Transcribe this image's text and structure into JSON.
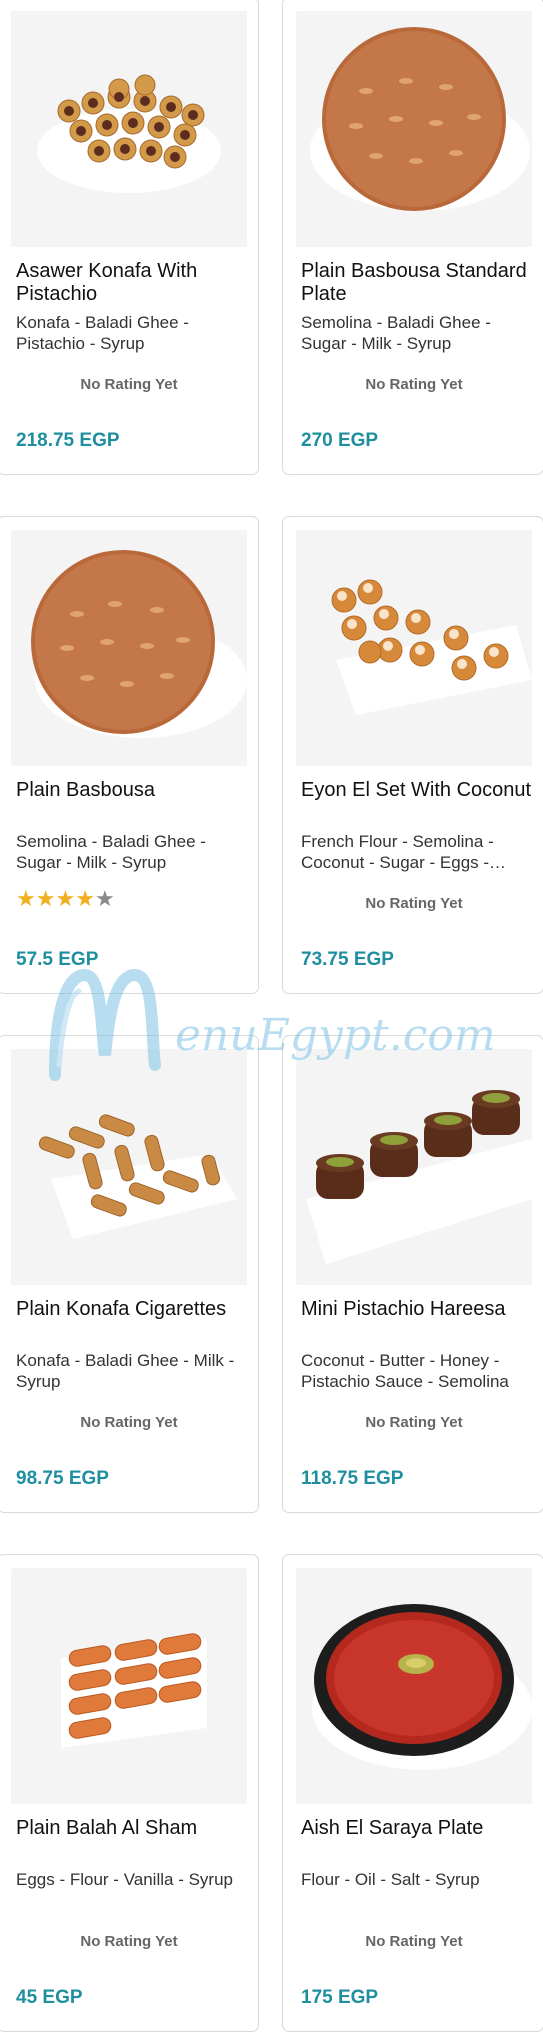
{
  "watermark": {
    "text": "enuEgypt.com"
  },
  "products": [
    {
      "name": "Asawer Konafa With Pistachio",
      "ingredients": "Konafa - Baladi Ghee - Pistachio - Syrup",
      "rating_text": "No Rating Yet",
      "price": "218.75 EGP",
      "image_icon": "asawer-konafa-photo"
    },
    {
      "name": "Plain Basbousa Standard Plate",
      "ingredients": "Semolina - Baladi Ghee - Sugar - Milk - Syrup",
      "rating_text": "No Rating Yet",
      "price": "270 EGP",
      "image_icon": "basbousa-plate-photo"
    },
    {
      "name": "Plain Basbousa",
      "ingredients": "Semolina - Baladi Ghee - Sugar - Milk - Syrup",
      "stars": 4,
      "stars_max": 5,
      "price": "57.5 EGP",
      "image_icon": "basbousa-photo"
    },
    {
      "name": "Eyon El Set With Coconut",
      "ingredients": "French Flour - Semolina - Coconut - Sugar - Eggs - Butter",
      "rating_text": "No Rating Yet",
      "price": "73.75 EGP",
      "image_icon": "eyon-el-set-photo"
    },
    {
      "name": "Plain Konafa Cigarettes",
      "ingredients": "Konafa - Baladi Ghee - Milk - Syrup",
      "rating_text": "No Rating Yet",
      "price": "98.75 EGP",
      "image_icon": "konafa-cigarettes-photo"
    },
    {
      "name": "Mini Pistachio Hareesa",
      "ingredients": "Coconut - Butter - Honey - Pistachio Sauce - Semolina",
      "rating_text": "No Rating Yet",
      "price": "118.75 EGP",
      "image_icon": "pistachio-hareesa-photo"
    },
    {
      "name": "Plain Balah Al Sham",
      "ingredients": "Eggs - Flour - Vanilla - Syrup",
      "rating_text": "No Rating Yet",
      "price": "45 EGP",
      "image_icon": "balah-al-sham-photo"
    },
    {
      "name": "Aish El Saraya Plate",
      "ingredients": "Flour - Oil - Salt - Syrup",
      "rating_text": "No Rating Yet",
      "price": "175 EGP",
      "image_icon": "aish-el-saraya-photo"
    }
  ],
  "colors": {
    "price": "#1f8fa0",
    "star_on": "#f2b01e",
    "star_off": "#8a8a8a",
    "border": "#d9d9d9"
  }
}
